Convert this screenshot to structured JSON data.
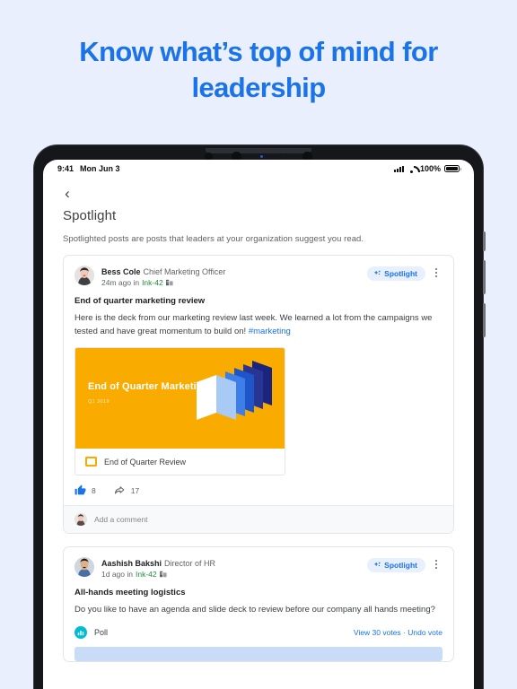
{
  "hero": {
    "title": "Know what’s top of mind for leadership",
    "accent_color": "#1a73e8",
    "background_color": "#e9effc"
  },
  "device": {
    "status_bar": {
      "time": "9:41",
      "date": "Mon Jun 3",
      "battery_percent": "100%",
      "signal_icon": "cellular-signal-icon",
      "wifi_icon": "wifi-icon",
      "battery_icon": "battery-full-icon"
    },
    "nav": {
      "back_icon": "‹"
    }
  },
  "page": {
    "title": "Spotlight",
    "subtitle": "Spotlighted posts are posts that leaders at your organization suggest you read."
  },
  "posts": [
    {
      "author": "Bess Cole",
      "role": "Chief Marketing Officer",
      "time": "24m ago in",
      "space": "Ink-42",
      "badge": "Spotlight",
      "title": "End of quarter marketing review",
      "body_before": "Here is the deck from our marketing review last week. We learned a lot from the campaigns we tested and have great momentum to build on! ",
      "hashtag": "#marketing",
      "attachment": {
        "slide_title": "End of Quarter Marketing Review",
        "slide_sub": "Q1 2019",
        "slide_bg": "#f9ab00",
        "file_name": "End of Quarter Review",
        "file_icon": "google-slides-icon"
      },
      "reactions": {
        "like_count": "8",
        "share_count": "17",
        "like_icon": "thumbs-up-icon",
        "share_icon": "share-arrow-icon"
      },
      "comment_placeholder": "Add a comment"
    },
    {
      "author": "Aashish Bakshi",
      "role": "Director of HR",
      "time": "1d ago in",
      "space": "Ink-42",
      "badge": "Spotlight",
      "title": "All-hands meeting logistics",
      "body_before": "Do you like to have an agenda and slide deck to review before our company all hands meeting?",
      "poll": {
        "label": "Poll",
        "icon": "poll-bar-chart-icon",
        "actions": "View 30 votes · Undo vote"
      }
    }
  ]
}
